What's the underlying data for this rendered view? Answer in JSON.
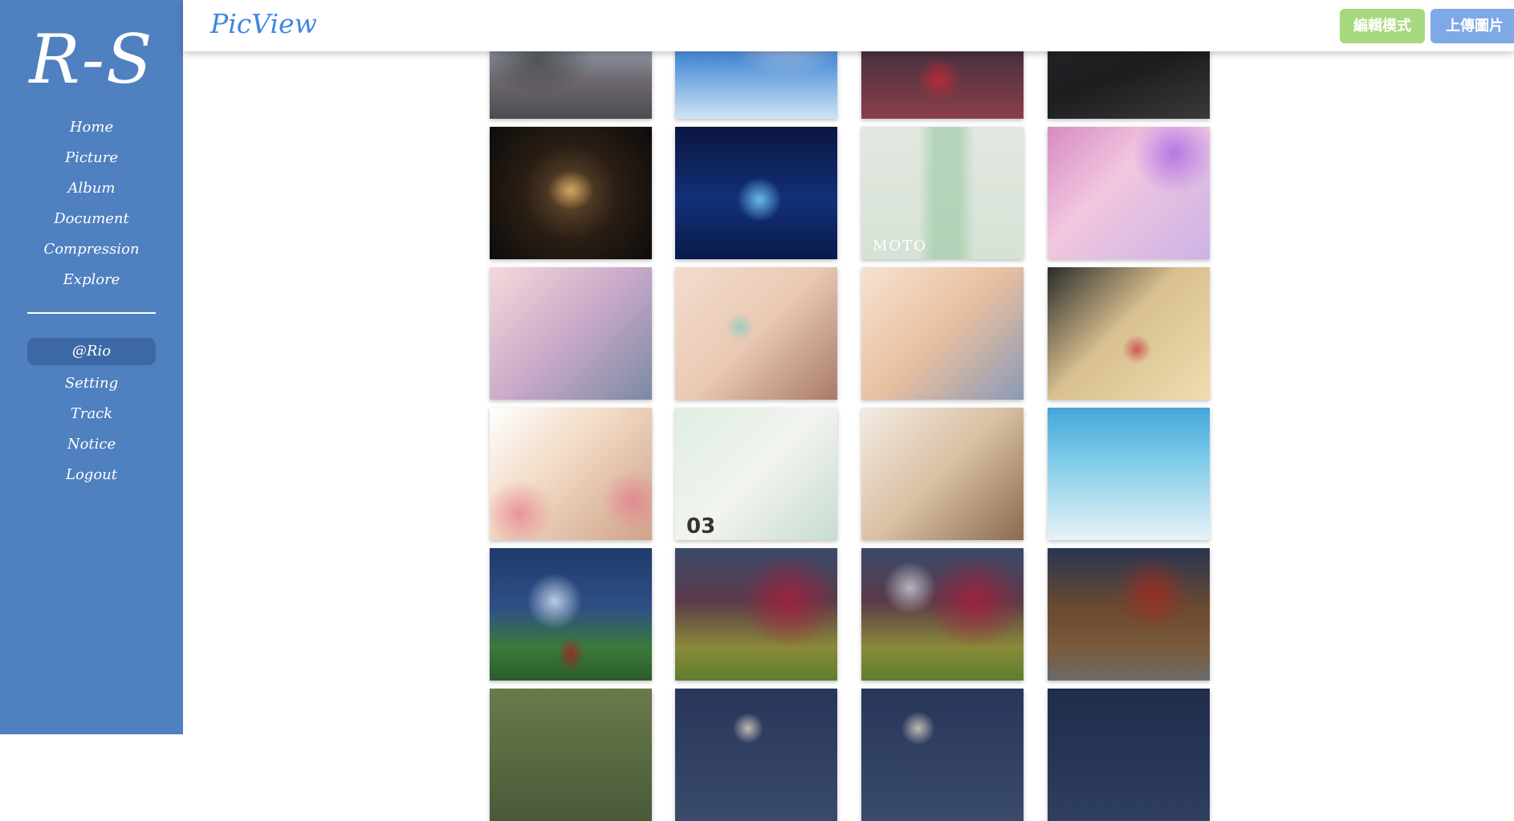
{
  "sidebar": {
    "logo": "R-S",
    "nav_items": [
      {
        "label": "Home"
      },
      {
        "label": "Picture"
      },
      {
        "label": "Album"
      },
      {
        "label": "Document"
      },
      {
        "label": "Compression"
      },
      {
        "label": "Explore"
      }
    ],
    "user_label": "@Rio",
    "account_items": [
      {
        "label": "Setting"
      },
      {
        "label": "Track"
      },
      {
        "label": "Notice"
      },
      {
        "label": "Logout"
      }
    ]
  },
  "header": {
    "brand": "PicView",
    "edit_mode_label": "編輯模式",
    "upload_label": "上傳圖片"
  },
  "colors": {
    "sidebar": "#4f80c0",
    "sidebar_active": "#3d68a6",
    "brand": "#3f86e0",
    "edit_button": "#a6d97f",
    "upload_button": "#7fa8e6"
  },
  "gallery": {
    "visible_text": {
      "number_tag": "03",
      "photo_mark": "MOTO"
    },
    "item_count": 24
  }
}
